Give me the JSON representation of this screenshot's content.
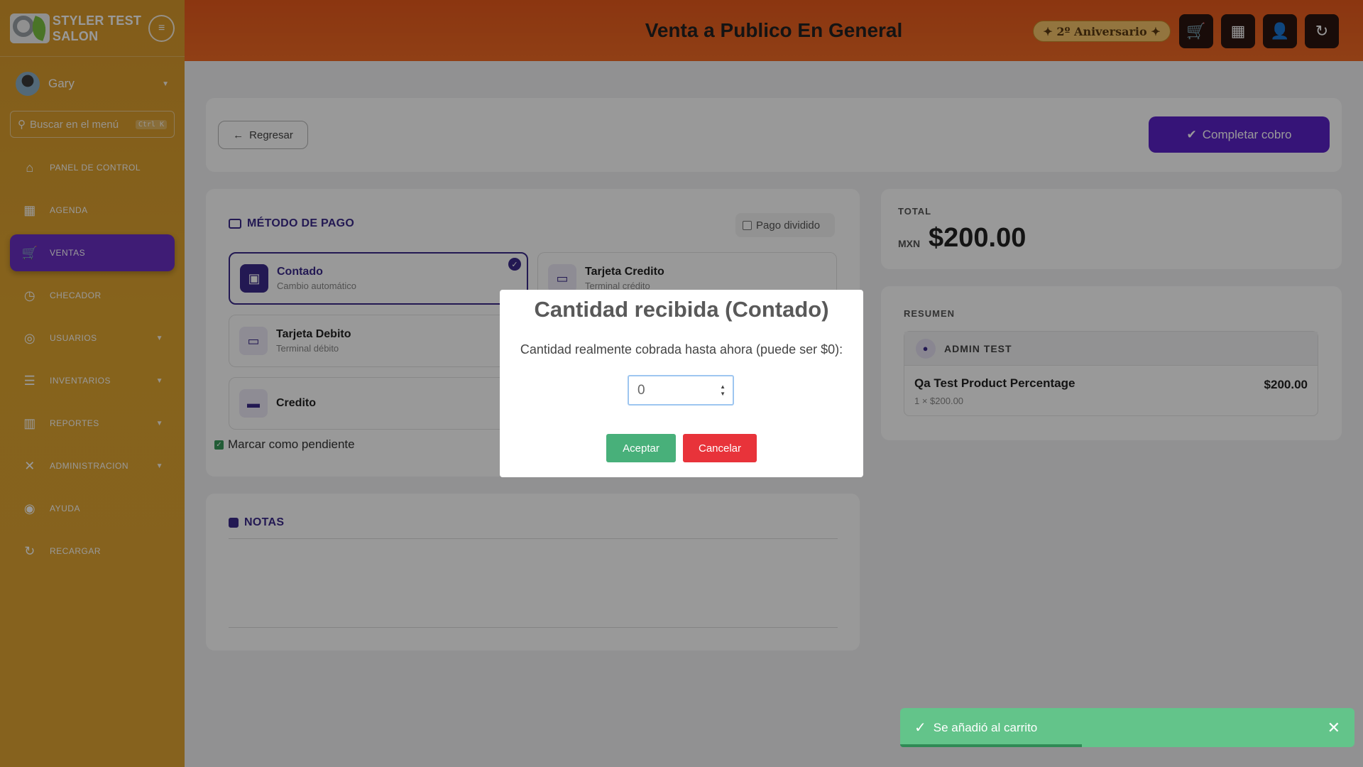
{
  "brand": {
    "name": "STYLER TEST SALON"
  },
  "user": {
    "name": "Gary"
  },
  "search": {
    "placeholder": "Buscar en el menú",
    "shortcut": "Ctrl K"
  },
  "nav": [
    {
      "label": "PANEL DE CONTROL",
      "icon": "store-icon",
      "glyph": "⌂"
    },
    {
      "label": "AGENDA",
      "icon": "calendar-icon",
      "glyph": "▦"
    },
    {
      "label": "VENTAS",
      "icon": "cart-icon",
      "glyph": "🛒"
    },
    {
      "label": "CHECADOR",
      "icon": "alarm-clock-icon",
      "glyph": "◷"
    },
    {
      "label": "USUARIOS",
      "icon": "user-circle-icon",
      "glyph": "◎"
    },
    {
      "label": "INVENTARIOS",
      "icon": "list-icon",
      "glyph": "☰"
    },
    {
      "label": "REPORTES",
      "icon": "bar-chart-icon",
      "glyph": "▥"
    },
    {
      "label": "ADMINISTRACION",
      "icon": "tools-icon",
      "glyph": "✕"
    },
    {
      "label": "AYUDA",
      "icon": "help-buoy-icon",
      "glyph": "◉"
    },
    {
      "label": "RECARGAR",
      "icon": "reload-icon",
      "glyph": "↻"
    }
  ],
  "header": {
    "title": "Venta a Publico En General",
    "anniversary": "✦ 2º Aniversario ✦"
  },
  "toolbar": {
    "back": "Regresar",
    "complete": "Completar cobro"
  },
  "payment": {
    "title": "MÉTODO DE PAGO",
    "split_label": "Pago dividido",
    "methods": [
      {
        "title": "Contado",
        "subtitle": "Cambio automático"
      },
      {
        "title": "Tarjeta Credito",
        "subtitle": "Terminal crédito"
      },
      {
        "title": "Tarjeta Debito",
        "subtitle": "Terminal débito"
      },
      {
        "title": "Credito",
        "subtitle": ""
      }
    ],
    "pending_label": "Marcar como pendiente"
  },
  "notes": {
    "title": "NOTAS"
  },
  "total": {
    "label": "TOTAL",
    "currency": "MXN",
    "amount": "$200.00"
  },
  "summary": {
    "label": "RESUMEN",
    "client": "ADMIN TEST",
    "item_name": "Qa Test Product Percentage",
    "item_detail": "1 × $200.00",
    "item_price": "$200.00"
  },
  "modal": {
    "title": "Cantidad recibida (Contado)",
    "text": "Cantidad realmente cobrada hasta ahora (puede ser $0):",
    "value": "0",
    "ok": "Aceptar",
    "cancel": "Cancelar"
  },
  "toast": {
    "message": "Se añadió al carrito",
    "progress": 0.4
  },
  "colors": {
    "accent": "#5b22c9",
    "sidebar": "#dfa433",
    "topbar": "#ee6522",
    "success": "#48b07a",
    "danger": "#e8333a"
  }
}
